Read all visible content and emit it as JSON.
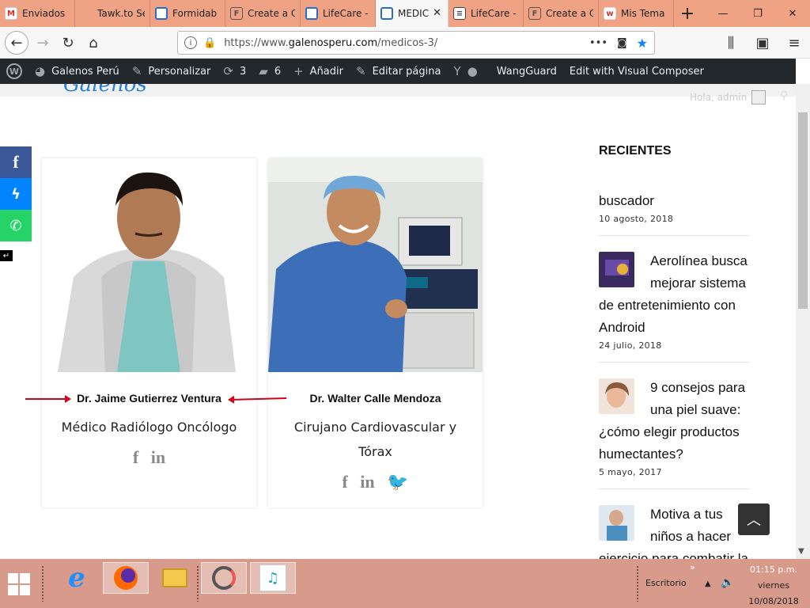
{
  "browser": {
    "tabs": [
      {
        "label": "Enviados",
        "icon": "gmail-icon",
        "fav": "fav-gmail",
        "glyph": "M"
      },
      {
        "label": "Tawk.to Settin",
        "icon": "tawk-icon",
        "fav": "fav-blank",
        "glyph": ""
      },
      {
        "label": "Formidab",
        "icon": "formidable-icon",
        "fav": "fav-ring",
        "glyph": ""
      },
      {
        "label": "Create a C",
        "icon": "formidable-f-icon",
        "fav": "fav-f",
        "glyph": "F"
      },
      {
        "label": "LifeCare -",
        "icon": "lifecare-icon",
        "fav": "fav-ring",
        "glyph": ""
      },
      {
        "label": "MEDIC",
        "icon": "medicos-icon",
        "fav": "fav-ring",
        "glyph": "",
        "active": true
      },
      {
        "label": "LifeCare -",
        "icon": "document-icon",
        "fav": "fav-doc",
        "glyph": "≡"
      },
      {
        "label": "Create a C",
        "icon": "formidable-f-icon",
        "fav": "fav-f",
        "glyph": "F"
      },
      {
        "label": "Mis Tema",
        "icon": "themeforest-icon",
        "fav": "fav-w",
        "glyph": "w"
      }
    ],
    "new_tab": "+",
    "minimize": "—",
    "restore": "❐",
    "close": "✕",
    "url_prefix": "https://www.",
    "url_host": "galenosperu.com",
    "url_path": "/medicos-3/",
    "page_actions": "•••"
  },
  "adminbar": {
    "site": "Galenos Perú",
    "customize": "Personalizar",
    "updates": "3",
    "comments": "6",
    "add": "Añadir",
    "edit_page": "Editar página",
    "wangguard": "WangGuard",
    "visual_composer": "Edit with Visual Composer"
  },
  "header": {
    "greeting": "Hola, admin"
  },
  "doctors": [
    {
      "name": "Dr. Jaime Gutierrez Ventura",
      "role": "Médico Radiólogo Oncólogo",
      "social": [
        "f",
        "in"
      ]
    },
    {
      "name": "Dr. Walter Calle Mendoza",
      "role": "Cirujano Cardiovascular y Tórax",
      "social": [
        "f",
        "in",
        "🐦"
      ]
    }
  ],
  "sidebar": {
    "title": "RECIENTES",
    "posts": [
      {
        "title": "buscador",
        "date": "10 agosto, 2018"
      },
      {
        "title": "Aerolínea busca mejorar sistema de entretenimiento con Android",
        "date": "24 julio, 2018"
      },
      {
        "title": "9 consejos para una piel suave: ¿cómo elegir productos humectantes?",
        "date": "5 mayo, 2017"
      },
      {
        "title": "Motiva a tus niños a hacer ejercicio para combatir la",
        "date": ""
      }
    ]
  },
  "taskbar": {
    "desktop": "Escritorio",
    "time": "01:15 p.m.",
    "day": "viernes",
    "date": "10/08/2018"
  }
}
